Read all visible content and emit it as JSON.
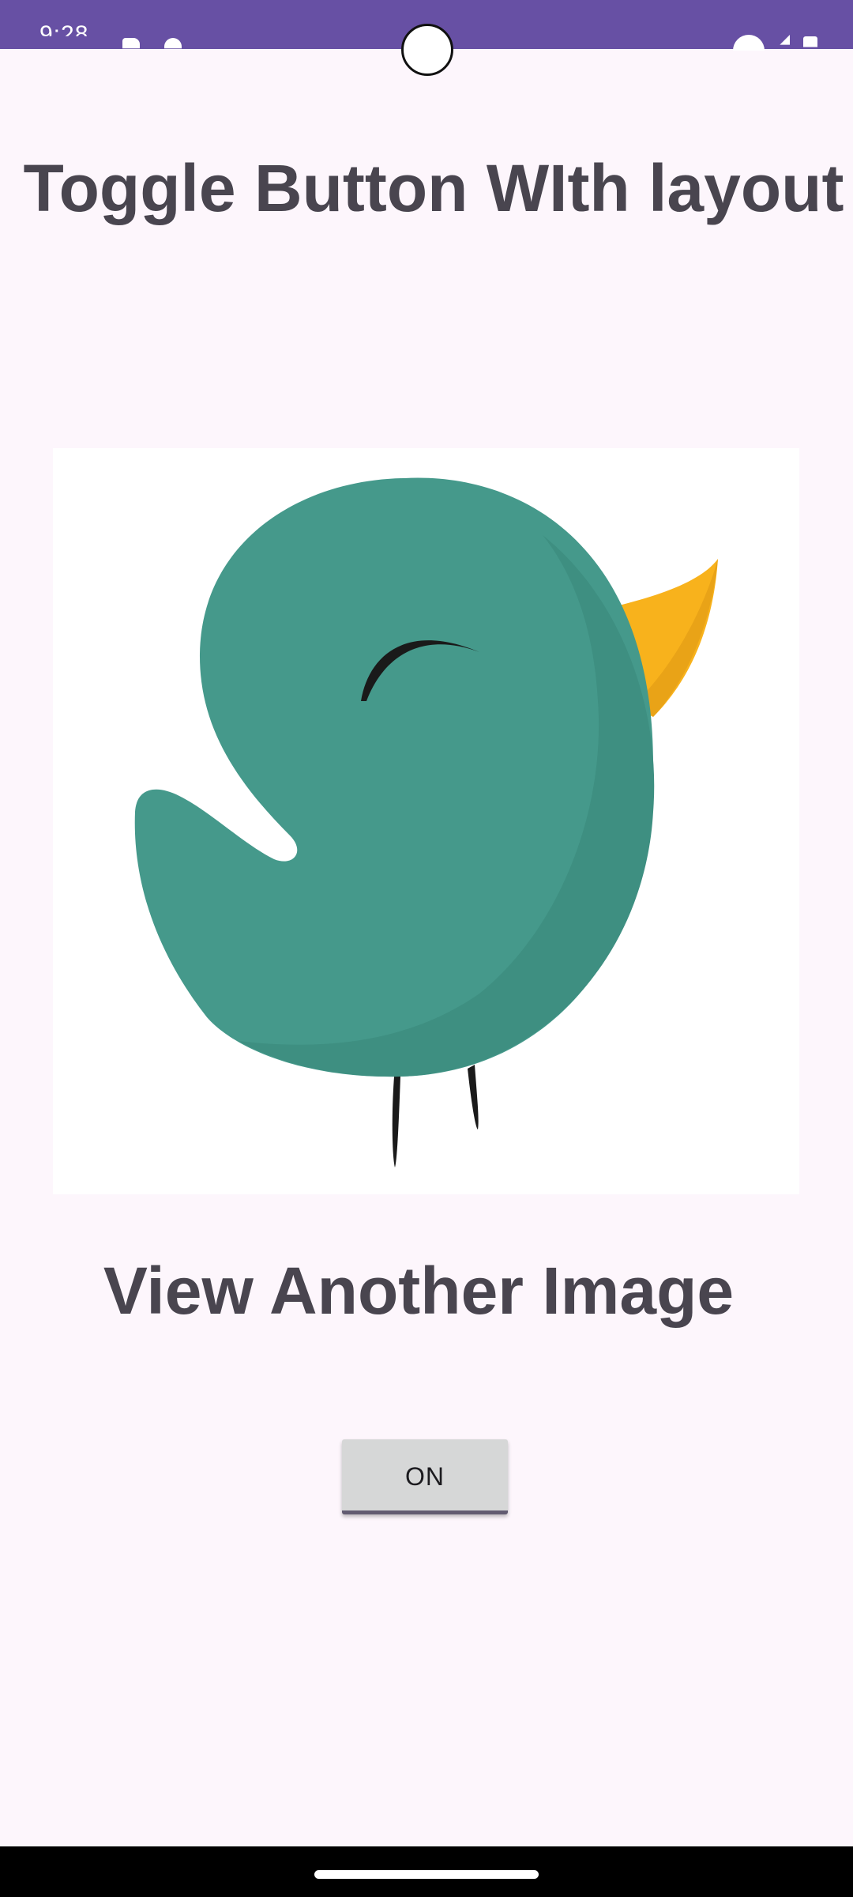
{
  "status_bar": {
    "time": "9:28",
    "background": "#6750A4",
    "icons": [
      "sd-card-icon",
      "bug-icon",
      "wifi-icon",
      "signal-icon",
      "battery-icon"
    ]
  },
  "main": {
    "title": "Toggle Button WIth layout",
    "image": {
      "description_icon": "green-bird-illustration",
      "colors": {
        "body": "#45998B",
        "body_shadow": "#3E8F81",
        "beak": "#F8B21C",
        "lines": "#1A1A1A"
      }
    },
    "subtitle": "View Another Image",
    "toggle_button": {
      "label": "ON",
      "checked": true,
      "background": "#D6D7D7",
      "indicator_color": "#625B71"
    }
  },
  "theme": {
    "background": "#FDF6FC",
    "text_color": "#49454F"
  }
}
